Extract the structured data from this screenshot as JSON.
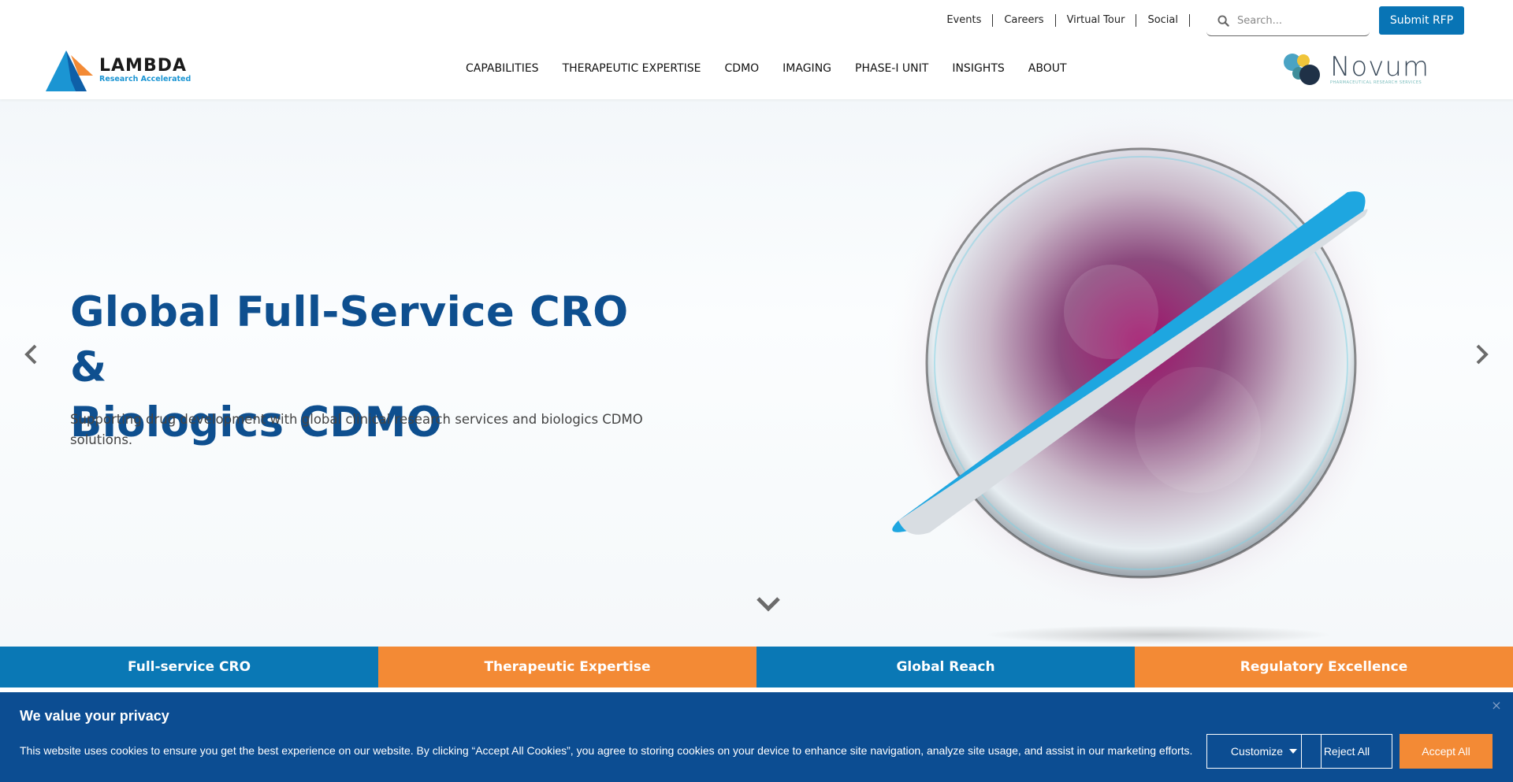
{
  "utility": {
    "links": [
      "Events",
      "Careers",
      "Virtual Tour",
      "Social"
    ],
    "search_placeholder": "Search...",
    "submit_rfp": "Submit RFP"
  },
  "brand": {
    "name": "LAMBDA",
    "tagline": "Research Accelerated",
    "partner_name": "Novum",
    "partner_tagline": "PHARMACEUTICAL RESEARCH SERVICES"
  },
  "nav": {
    "items": [
      "CAPABILITIES",
      "THERAPEUTIC EXPERTISE",
      "CDMO",
      "IMAGING",
      "PHASE-I UNIT",
      "INSIGHTS",
      "ABOUT"
    ]
  },
  "hero": {
    "title_line1": "Global Full-Service CRO &",
    "title_line2": "Biologics CDMO",
    "subtitle": "Supporting drug development with global clinical research services and biologics CDMO solutions."
  },
  "features": [
    {
      "label": "Full-service CRO",
      "color": "#0a78b5"
    },
    {
      "label": "Therapeutic Expertise",
      "color": "#f38a35"
    },
    {
      "label": "Global Reach",
      "color": "#0a78b5"
    },
    {
      "label": "Regulatory Excellence",
      "color": "#f38a35"
    }
  ],
  "cookie": {
    "title": "We value your privacy",
    "text": "This website uses cookies to ensure you get the best experience on our website. By clicking “Accept All Cookies”, you agree to storing cookies on your device to enhance site navigation, analyze site usage, and assist in our marketing efforts.",
    "customize": "Customize",
    "reject": "Reject All",
    "accept": "Accept All",
    "close": "×"
  },
  "icons": {
    "search": "search-icon",
    "prev": "chevron-left-icon",
    "next": "chevron-right-icon",
    "scroll": "chevron-down-icon",
    "close": "close-icon"
  },
  "colors": {
    "brand_blue": "#0a78b5",
    "brand_orange": "#f38a35",
    "title_blue": "#0e4f8f",
    "cookie_bg": "#0c4d92"
  }
}
